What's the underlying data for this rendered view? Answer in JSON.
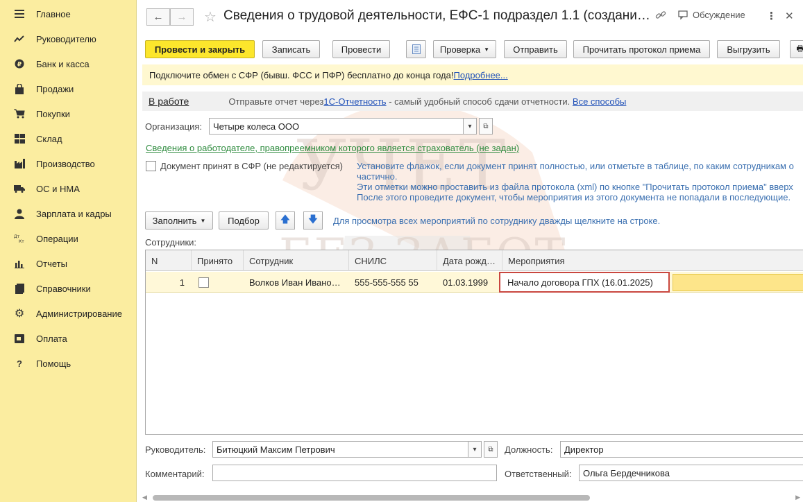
{
  "sidebar": {
    "items": [
      {
        "label": "Главное",
        "icon": "menu-icon"
      },
      {
        "label": "Руководителю",
        "icon": "trend-icon"
      },
      {
        "label": "Банк и касса",
        "icon": "coin-icon"
      },
      {
        "label": "Продажи",
        "icon": "bag-icon"
      },
      {
        "label": "Покупки",
        "icon": "cart-icon"
      },
      {
        "label": "Склад",
        "icon": "warehouse-icon"
      },
      {
        "label": "Производство",
        "icon": "factory-icon"
      },
      {
        "label": "ОС и НМА",
        "icon": "truck-icon"
      },
      {
        "label": "Зарплата и кадры",
        "icon": "person-icon"
      },
      {
        "label": "Операции",
        "icon": "dt-kt-icon"
      },
      {
        "label": "Отчеты",
        "icon": "bar-chart-icon"
      },
      {
        "label": "Справочники",
        "icon": "book-icon"
      },
      {
        "label": "Администрирование",
        "icon": "gear-icon"
      },
      {
        "label": "Оплата",
        "icon": "payment-icon"
      },
      {
        "label": "Помощь",
        "icon": "help-icon"
      }
    ]
  },
  "window": {
    "title": "Сведения о трудовой деятельности, ЕФС-1 подраздел 1.1 (создани…",
    "discuss_label": "Обсуждение"
  },
  "toolbar": {
    "post_close": "Провести и закрыть",
    "save": "Записать",
    "post": "Провести",
    "check": "Проверка",
    "send": "Отправить",
    "read_protocol": "Прочитать протокол приема",
    "export": "Выгрузить"
  },
  "banner": {
    "text": "Подключите обмен с СФР (бывш. ФСС и ПФР) бесплатно до конца года! ",
    "link": "Подробнее..."
  },
  "status": {
    "state": "В работе",
    "hint_prefix": "Отправьте отчет через ",
    "hint_link": "1С-Отчетность",
    "hint_suffix": " - самый удобный способ сдачи отчетности. ",
    "all_ways": "Все способы"
  },
  "form": {
    "org_label": "Организация:",
    "org_value": "Четыре колеса ООО",
    "employer_link": "Сведения о работодателе, правопреемником которого является страхователь (не задан)",
    "accepted_label": "Документ принят в СФР (не редактируется)",
    "info_lines": [
      "Установите флажок, если документ принят полностью, или отметьте в таблице, по каким сотрудникам о",
      "частично.",
      "Эти отметки можно проставить из файла протокола (xml) по кнопке \"Прочитать протокол приема\" вверх",
      "После этого проведите документ, чтобы мероприятия из этого документа не попадали в последующие."
    ]
  },
  "table_toolbar": {
    "fill": "Заполнить",
    "pick": "Подбор",
    "hint": "Для просмотра всех мероприятий по сотруднику дважды щелкните на строке."
  },
  "table": {
    "caption": "Сотрудники:",
    "columns": [
      "N",
      "Принято",
      "Сотрудник",
      "СНИЛС",
      "Дата рожд…",
      "Мероприятия"
    ],
    "rows": [
      {
        "n": "1",
        "employee": "Волков Иван Ивано…",
        "snils": "555-555-555 55",
        "birth": "01.03.1999",
        "event": "Начало договора ГПХ (16.01.2025)"
      }
    ]
  },
  "footer": {
    "head_label": "Руководитель:",
    "head_value": "Битюцкий Максим Петрович",
    "position_label": "Должность:",
    "position_value": "Директор",
    "comment_label": "Комментарий:",
    "comment_value": "",
    "responsible_label": "Ответственный:",
    "responsible_value": "Ольга Бердечникова"
  },
  "watermark": {
    "line1": "УЧЕТ",
    "line2": "БЕЗ ЗАБОТ"
  }
}
